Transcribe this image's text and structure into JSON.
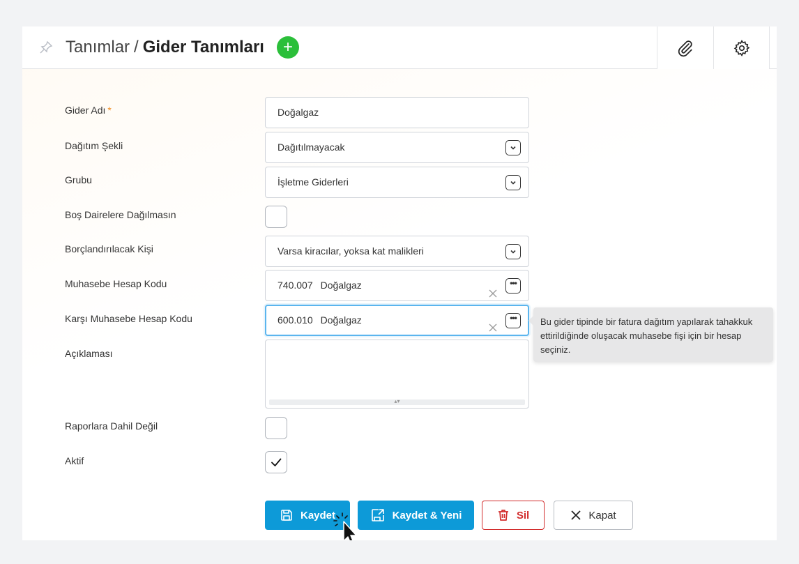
{
  "header": {
    "breadcrumb": "Tanımlar",
    "separator": "/",
    "page_title": "Gider Tanımları",
    "add_label": "+"
  },
  "form": {
    "gider_adi": {
      "label": "Gider Adı",
      "required_mark": "*",
      "value": "Doğalgaz"
    },
    "dagitim_sekli": {
      "label": "Dağıtım Şekli",
      "value": "Dağıtılmayacak"
    },
    "grubu": {
      "label": "Grubu",
      "value": "İşletme Giderleri"
    },
    "bos_daireler": {
      "label": "Boş Dairelere Dağılmasın",
      "checked": false
    },
    "borclandirilacak": {
      "label": "Borçlandırılacak Kişi",
      "value": "Varsa kiracılar, yoksa kat malikleri"
    },
    "muhasebe_kodu": {
      "label": "Muhasebe Hesap Kodu",
      "code": "740.007",
      "name": "Doğalgaz"
    },
    "karsi_muhasebe_kodu": {
      "label": "Karşı Muhasebe Hesap Kodu",
      "code": "600.010",
      "name": "Doğalgaz"
    },
    "aciklama": {
      "label": "Açıklaması",
      "value": ""
    },
    "raporlara_dahil_degil": {
      "label": "Raporlara Dahil Değil",
      "checked": false
    },
    "aktif": {
      "label": "Aktif",
      "checked": true
    }
  },
  "tooltip": {
    "text": "Bu gider tipinde bir fatura dağıtım yapılarak tahakkuk ettirildiğinde oluşacak muhasebe fişi için bir hesap seçiniz."
  },
  "buttons": {
    "save": "Kaydet",
    "save_new": "Kaydet & Yeni",
    "delete": "Sil",
    "close": "Kapat"
  },
  "colors": {
    "primary": "#0d9ad8",
    "add": "#2bbf3a",
    "danger": "#d22c2c",
    "required": "#f08a1c",
    "focus": "#5bb5ee"
  },
  "icons": [
    "pin-icon",
    "plus-icon",
    "paperclip-icon",
    "gear-icon",
    "chevron-down-icon",
    "ellipsis-icon",
    "clear-icon",
    "check-icon",
    "floppy-icon",
    "save-export-icon",
    "trash-icon",
    "close-icon",
    "cursor-icon"
  ]
}
